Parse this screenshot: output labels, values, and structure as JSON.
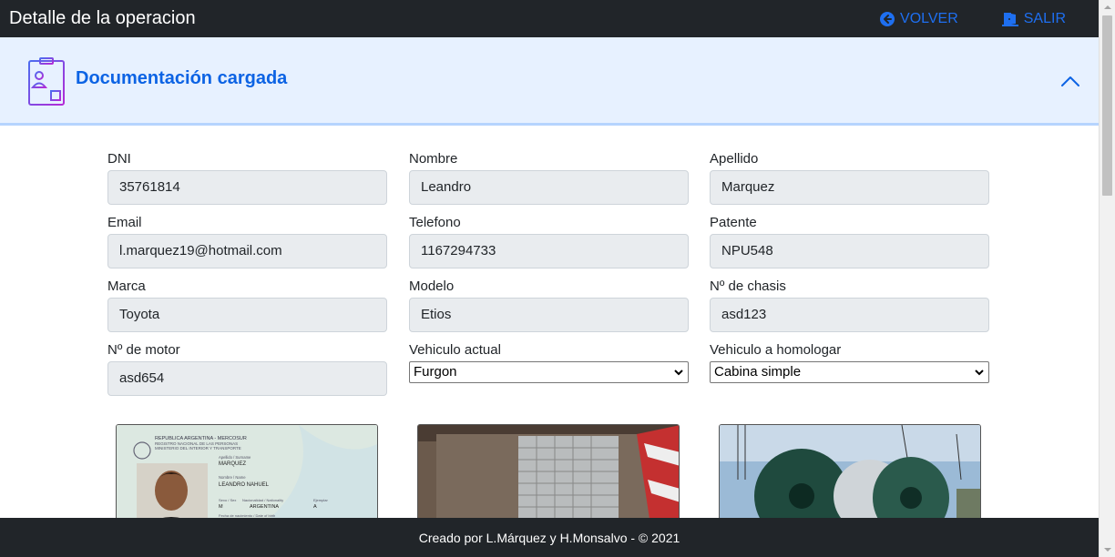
{
  "navbar": {
    "title": "Detalle de la operacion",
    "volver_label": "VOLVER",
    "salir_label": "SALIR",
    "link_color": "#1e6ff0"
  },
  "accordion": {
    "title": "Documentación cargada",
    "icon": "id-card-icon",
    "expanded": true
  },
  "form": {
    "dni": {
      "label": "DNI",
      "value": "35761814"
    },
    "nombre": {
      "label": "Nombre",
      "value": "Leandro"
    },
    "apellido": {
      "label": "Apellido",
      "value": "Marquez"
    },
    "email": {
      "label": "Email",
      "value": "l.marquez19@hotmail.com"
    },
    "telefono": {
      "label": "Telefono",
      "value": "1167294733"
    },
    "patente": {
      "label": "Patente",
      "value": "NPU548"
    },
    "marca": {
      "label": "Marca",
      "value": "Toyota"
    },
    "modelo": {
      "label": "Modelo",
      "value": "Etios"
    },
    "chasis": {
      "label": "Nº de chasis",
      "value": "asd123"
    },
    "motor": {
      "label": "Nº de motor",
      "value": "asd654"
    },
    "vehiculo_actual": {
      "label": "Vehiculo actual",
      "value": "Furgon"
    },
    "vehiculo_homologar": {
      "label": "Vehiculo a homologar",
      "value": "Cabina simple"
    }
  },
  "images": {
    "id_card": {
      "header": "REPUBLICA ARGENTINA - MERCOSUR",
      "sub1": "REGISTRO NACIONAL DE LAS PERSONAS",
      "sub2": "MINISTERIO DEL INTERIOR Y TRANSPORTE",
      "apellido_label": "Apellido / Surname",
      "apellido": "MARQUEZ",
      "nombre_label": "Nombre / Name",
      "nombre": "LEANDRO NAHUEL",
      "sexo_label": "Sexo / Sex",
      "sexo": "M",
      "nacionalidad_label": "Nacionalidad / Nationality",
      "nacionalidad": "ARGENTINA",
      "ejemplar_label": "Ejemplar",
      "ejemplar": "A",
      "fecha_label": "Fecha de nacimiento / Date of birth"
    }
  },
  "footer": {
    "text": "Creado por L.Márquez y H.Monsalvo - © 2021"
  }
}
